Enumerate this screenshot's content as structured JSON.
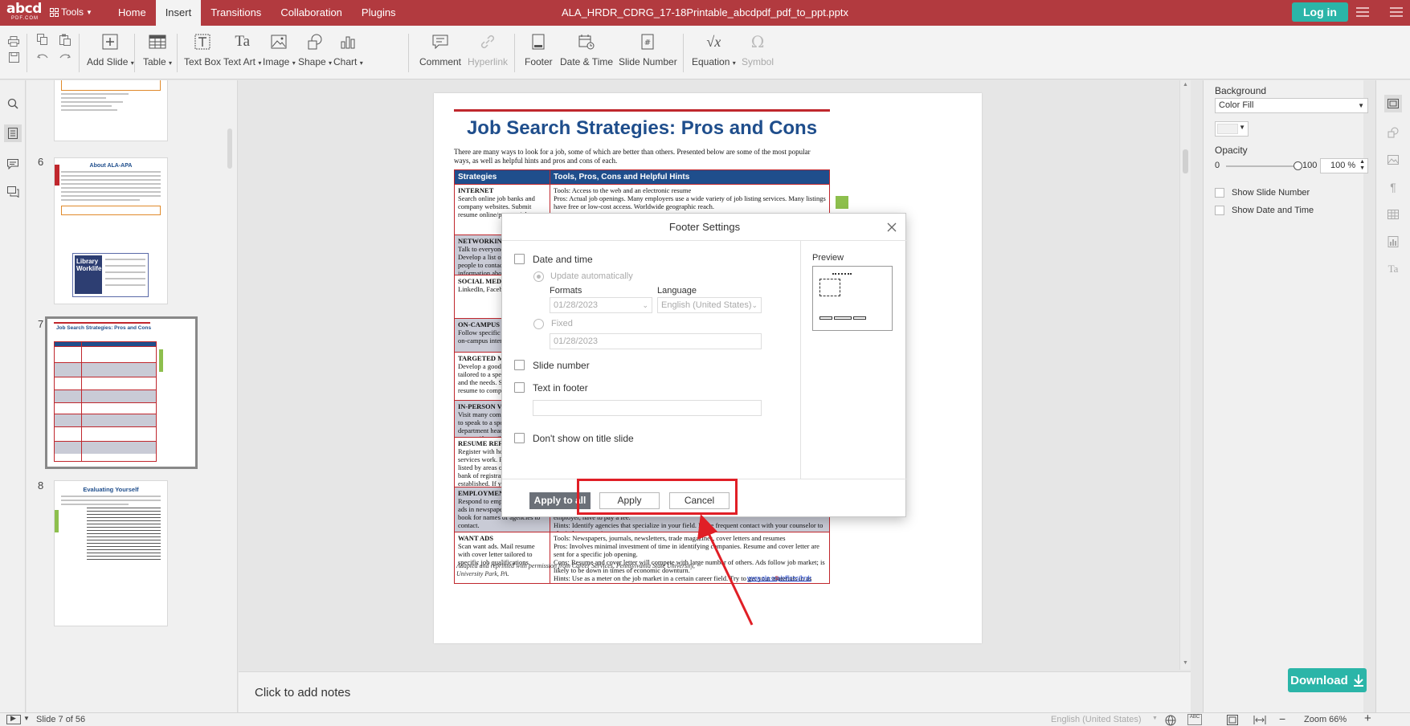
{
  "app": {
    "logo_text": "abcd",
    "logo_sub": "PDF.COM",
    "tools_label": "Tools",
    "menu_tabs": [
      "Home",
      "Insert",
      "Transitions",
      "Collaboration",
      "Plugins"
    ],
    "active_tab": "Insert",
    "document_title": "ALA_HRDR_CDRG_17-18Printable_abcdpdf_pdf_to_ppt.pptx",
    "login_label": "Log in",
    "colors": {
      "brand_red": "#b23a3f",
      "teal": "#2bb5a8",
      "slide_blue": "#1f4e8c",
      "slide_red": "#c0272d"
    }
  },
  "toolbar": {
    "add_slide": "Add Slide",
    "table": "Table",
    "text_box": "Text Box",
    "text_art": "Text Art",
    "image": "Image",
    "shape": "Shape",
    "chart": "Chart",
    "comment": "Comment",
    "hyperlink": "Hyperlink",
    "footer": "Footer",
    "date_time": "Date & Time",
    "slide_number": "Slide Number",
    "equation": "Equation",
    "symbol": "Symbol"
  },
  "thumbnails": {
    "items": [
      {
        "number": "6",
        "title": "About ALA-APA"
      },
      {
        "number": "7",
        "title": "Job Search Strategies: Pros and Cons"
      },
      {
        "number": "8",
        "title": "Evaluating Yourself"
      }
    ],
    "thumb6_image_text": "Library Worklife"
  },
  "slide": {
    "title": "Job Search Strategies: Pros and Cons",
    "intro": "There are many ways to look for a job, some of which are better than others. Presented below are some of the most popular ways, as well as helpful hints and pros and cons of each.",
    "col1_header": "Strategies",
    "col2_header": "Tools, Pros, Cons and Helpful Hints",
    "rows": [
      {
        "strategy": "INTERNET",
        "strategy_text": "Search online job banks and company websites. Submit resume online/post on job",
        "hints": "Tools: Access to the web and an electronic resume\nPros: Actual job openings. Many employers use a wide variety of job listing services. Many listings have free or low-cost access. Worldwide geographic reach."
      },
      {
        "strategy": "NETWORKING",
        "strategy_text": "Talk to everyone you know. Develop a list of possible people to contact and ask for information about companies and to pass along your resume.",
        "hints": ""
      },
      {
        "strategy": "SOCIAL MEDIA",
        "strategy_text": "LinkedIn, Facebook",
        "hints": ""
      },
      {
        "strategy": "ON-CAMPUS",
        "strategy_text": "Follow specific procedures for on-campus interviews",
        "hints": ""
      },
      {
        "strategy": "TARGETED MAILINGS",
        "strategy_text": "Develop a good cover letter tailored to a specific employer and the needs. Send letter with resume to companies.",
        "hints": ""
      },
      {
        "strategy": "IN-PERSON VISITS",
        "strategy_text": "Visit many companies and ask to speak to a specific department head. Submit resume if possible.",
        "hints": ""
      },
      {
        "strategy": "RESUME REFERRAL",
        "strategy_text": "Register with how such referral services work. Resumes are listed by areas of interest. A bank of registrants is established. If your resume matches, they are sent to employers.",
        "hints": ""
      },
      {
        "strategy": "EMPLOYMENT AGENCIES",
        "strategy_text": "Respond to employment agency ads in newspapers; check phone book for names of agencies to contact.",
        "hints": "Tools: Resumes and business attire\nPros: Fee-paid jobs for graduates in technical fields or those with marketable experience.\nCons: May be less help to non-technical/inexperienced graduates. Be wary if you, instead of the employer, have to pay a fee.\nHints: Identify agencies that specialize in your field. Make frequent contact with your counselor to obtain better service."
      },
      {
        "strategy": "WANT ADS",
        "strategy_text": "Scan want ads. Mail resume with cover letter tailored to specific job qualifications.",
        "hints": "Tools: Newspapers, journals, newsletters, trade magazines, cover letters and resumes\nPros: Involves minimal investment of time in identifying companies. Resume and cover letter are sent for a specific job opening.\nCons: Resume and cover letter will compete with large number of others. Ads follow job market; is likely to be down in times of economic downturn.\nHints: Use as a meter on the job market in a certain career field. Try to get your materials in as early as possible."
      }
    ],
    "footnote": "Adapted and reprinted with permission from Career Services, Pennsylvania State University, University Park, PA.",
    "link": "www.ala.org/offices/hrdr",
    "page_number": "5"
  },
  "notes_placeholder": "Click to add notes",
  "right_panel": {
    "background_label": "Background",
    "fill_option": "Color Fill",
    "opacity_label": "Opacity",
    "opacity_min": "0",
    "opacity_max": "100",
    "opacity_value": "100 %",
    "opacity_fraction": 1.0,
    "show_slide_number": "Show Slide Number",
    "show_date_time": "Show Date and Time"
  },
  "dialog": {
    "title": "Footer Settings",
    "date_time": "Date and time",
    "update_auto": "Update automatically",
    "formats_label": "Formats",
    "format_value": "01/28/2023",
    "language_label": "Language",
    "language_value": "English (United States)",
    "fixed_label": "Fixed",
    "fixed_value": "01/28/2023",
    "slide_number": "Slide number",
    "text_in_footer": "Text in footer",
    "footer_text_value": "",
    "dont_show_title": "Don't show on title slide",
    "preview_label": "Preview",
    "apply_all": "Apply to all",
    "apply": "Apply",
    "cancel": "Cancel"
  },
  "status": {
    "slide_info": "Slide 7 of 56",
    "language": "English (United States)",
    "zoom": "Zoom 66%"
  },
  "download_label": "Download"
}
